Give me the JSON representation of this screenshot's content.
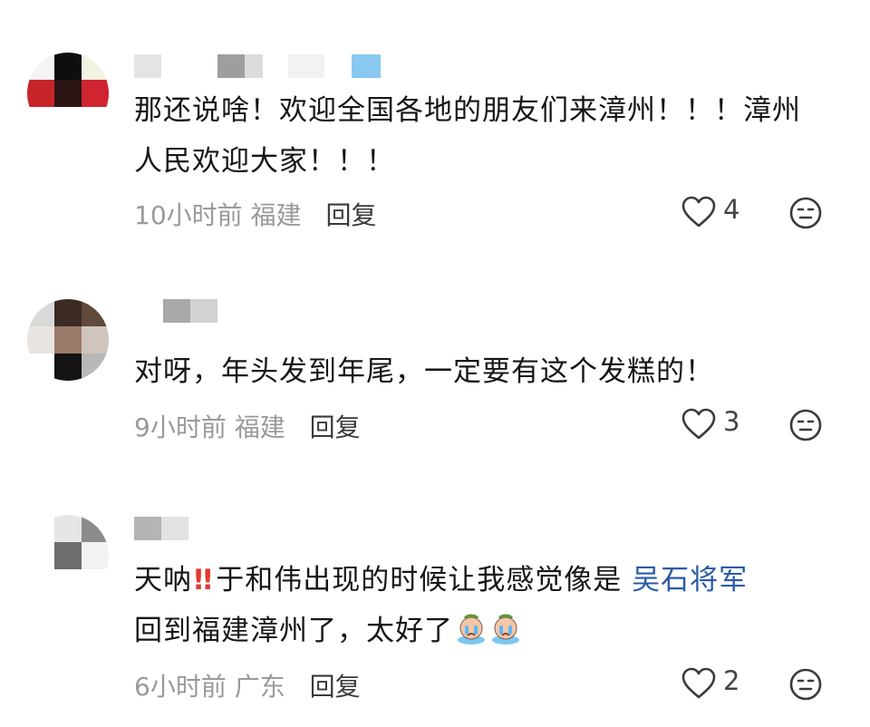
{
  "comments": [
    {
      "text_lines": [
        "那还说啥！欢迎全国各地的朋友们来漳州！！！漳州",
        "人民欢迎大家！！！"
      ],
      "time": "10小时前",
      "location": "福建",
      "reply_label": "回复",
      "likes": "4"
    },
    {
      "text_lines": [
        "对呀，年头发到年尾，一定要有这个发糕的！"
      ],
      "time": "9小时前",
      "location": "福建",
      "reply_label": "回复",
      "likes": "3"
    },
    {
      "text_prefix": "天呐",
      "text_middle": "于和伟出现的时候让我感觉像是 ",
      "mention": "吴石将军",
      "text_line2": "回到福建漳州了，太好了",
      "time": "6小时前",
      "location": "广东",
      "reply_label": "回复",
      "likes": "2"
    }
  ],
  "icons": {
    "like": "heart-outline-icon",
    "react": "neutral-face-icon",
    "exclaim": "double-exclamation-icon",
    "emoji": "crying-face-emoji"
  },
  "colors": {
    "mention": "#2a5aa8",
    "exclaim": "#e23a2e",
    "meta": "#9a9a9a"
  }
}
